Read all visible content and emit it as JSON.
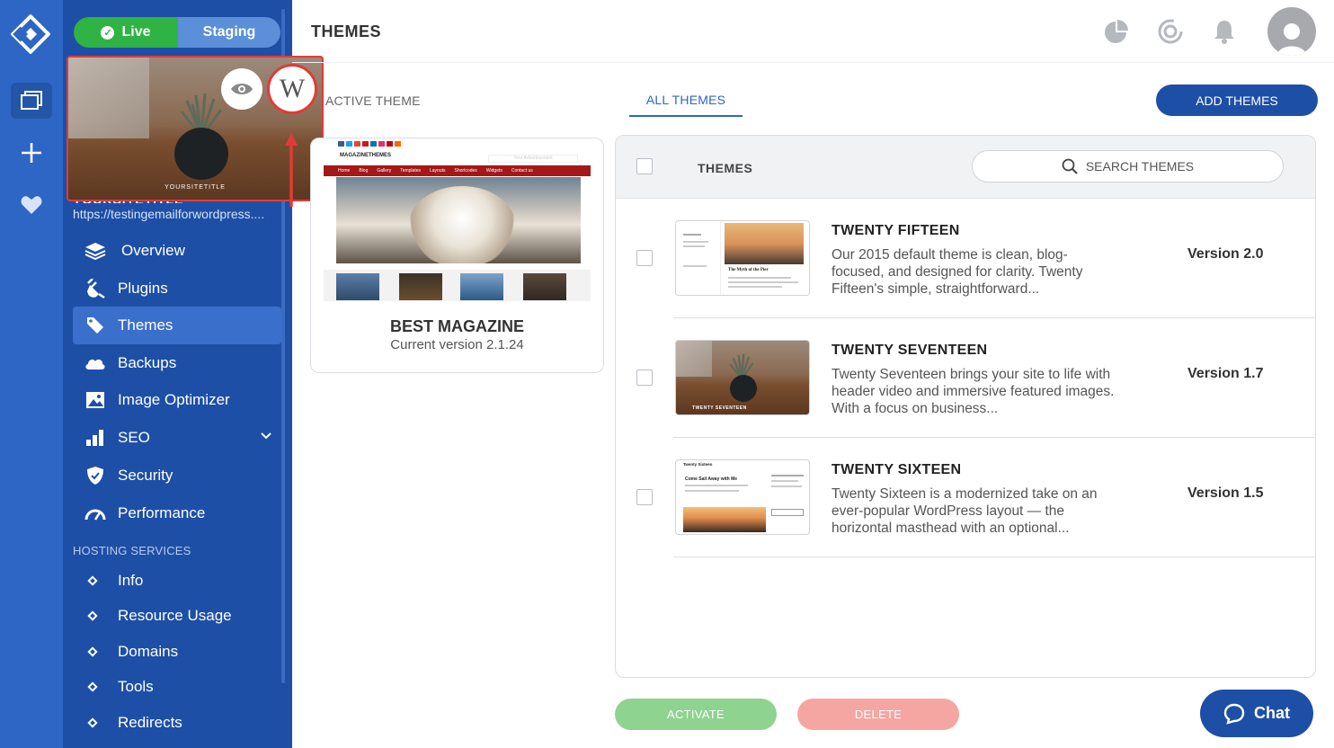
{
  "app": {
    "page_title": "THEMES"
  },
  "environment": {
    "live_label": "Live",
    "staging_label": "Staging"
  },
  "site": {
    "url": "https://testingemailforwordpress....",
    "title": "YOURSITETITLE",
    "preview_caption": "YOURSITETITLE"
  },
  "sidebar": {
    "items": [
      {
        "label": "Overview",
        "icon": "layers-icon"
      },
      {
        "label": "Plugins",
        "icon": "plug-icon"
      },
      {
        "label": "Themes",
        "icon": "brush-icon",
        "active": true
      },
      {
        "label": "Backups",
        "icon": "cloud-icon"
      },
      {
        "label": "Image Optimizer",
        "icon": "image-icon"
      },
      {
        "label": "SEO",
        "icon": "bar-chart-icon"
      },
      {
        "label": "Security",
        "icon": "shield-icon"
      },
      {
        "label": "Performance",
        "icon": "gauge-icon"
      }
    ],
    "hosting_section_label": "HOSTING SERVICES",
    "hosting_items": [
      "Info",
      "Resource Usage",
      "Domains",
      "Tools",
      "Redirects"
    ]
  },
  "tabs": {
    "active_theme": "ACTIVE THEME",
    "all_themes": "ALL THEMES"
  },
  "add_themes_label": "ADD THEMES",
  "active_theme": {
    "name": "BEST MAGAZINE",
    "version": "Current version 2.1.24",
    "thumb_logo": "MAGAZINETHEMES",
    "thumb_ad": "Your Advertisement",
    "thumb_nav": [
      "Home",
      "Blog",
      "Gallery",
      "Templates",
      "Layouts",
      "Shortcodes",
      "Widgets",
      "Contact us"
    ]
  },
  "themes_panel": {
    "header_label": "THEMES",
    "search_placeholder": "SEARCH THEMES",
    "rows": [
      {
        "name": "TWENTY FIFTEEN",
        "desc": "Our 2015 default theme is clean, blog-focused, and designed for clarity. Twenty Fifteen's simple, straightforward...",
        "version": "Version 2.0",
        "thumb_caption": "The Myth of the Pier"
      },
      {
        "name": "TWENTY SEVENTEEN",
        "desc": "Twenty Seventeen brings your site to life with header video and immersive featured images. With a focus on business...",
        "version": "Version 1.7",
        "thumb_caption": "TWENTY SEVENTEEN"
      },
      {
        "name": "TWENTY SIXTEEN",
        "desc": "Twenty Sixteen is a modernized take on an ever-popular WordPress layout — the horizontal masthead with an optional...",
        "version": "Version 1.5",
        "thumb_caption": "Come Sail Away with Me",
        "thumb_brand": "Twenty Sixteen"
      }
    ]
  },
  "actions": {
    "activate": "ACTIVATE",
    "delete": "DELETE",
    "chat": "Chat"
  },
  "colors": {
    "brand_blue": "#2d66c4",
    "sidebar_blue": "#1e4fa6",
    "live_green": "#2fb344",
    "activate_green": "#8ed38f",
    "delete_red": "#f6a6a2",
    "highlight_red": "#e23b35"
  }
}
